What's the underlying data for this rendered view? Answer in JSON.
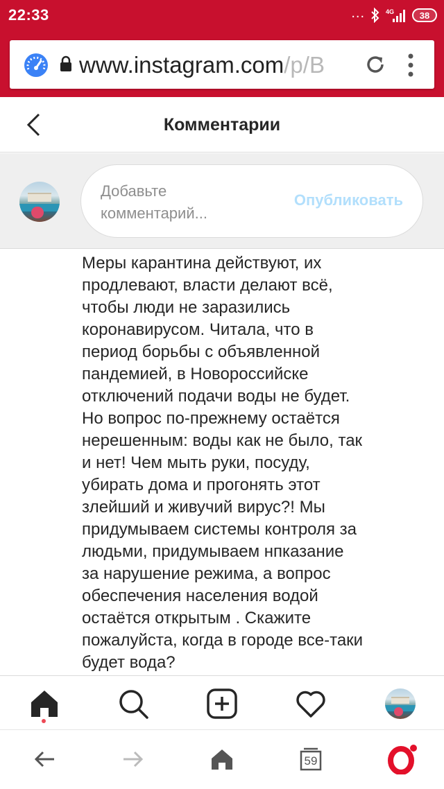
{
  "status_bar": {
    "time": "22:33",
    "dots": "...",
    "battery": "38"
  },
  "browser": {
    "url_main": "www.instagram.com",
    "url_rest": "/p/B",
    "open_tabs": "59"
  },
  "header": {
    "title": "Комментарии"
  },
  "add_comment": {
    "placeholder": "Добавьте\nкомментарий...",
    "publish_label": "Опубликовать"
  },
  "comment": {
    "text": "Меры карантина действуют, их\nпродлевают, власти делают всё,\nчтобы люди не заразились\nкоронавирусом. Читала, что в\nпериод борьбы с объявленной\nпандемией, в Новороссийске\nотключений подачи воды не будет.\nНо вопрос по-прежнему остаётся\nнерешенным: воды как не было, так\nи нет! Чем мыть руки, посуду,\nубирать дома и прогонять этот\nзлейший и живучий вирус?! Мы\nпридумываем системы контроля за\nлюдьми, придумываем нпказание\nза нарушение режима, а вопрос\nобеспечения населения водой\nостаётся открытым . Скажите\nпожалуйста, когда в городе все-таки\nбудет вода?"
  },
  "icons": {
    "browser_status": "speedometer-icon",
    "lock": "lock-icon",
    "reload": "reload-icon",
    "menu": "more-vertical-icon",
    "back": "chevron-left-icon",
    "nav": [
      "home-icon",
      "search-icon",
      "add-post-icon",
      "heart-icon",
      "profile-avatar"
    ],
    "opera": [
      "back-arrow-icon",
      "forward-arrow-icon",
      "home-icon",
      "tabs-icon",
      "opera-logo-icon"
    ]
  },
  "colors": {
    "browser_red": "#c8102e",
    "publish_blue": "#b2dffc",
    "notification_red": "#ed4956"
  }
}
